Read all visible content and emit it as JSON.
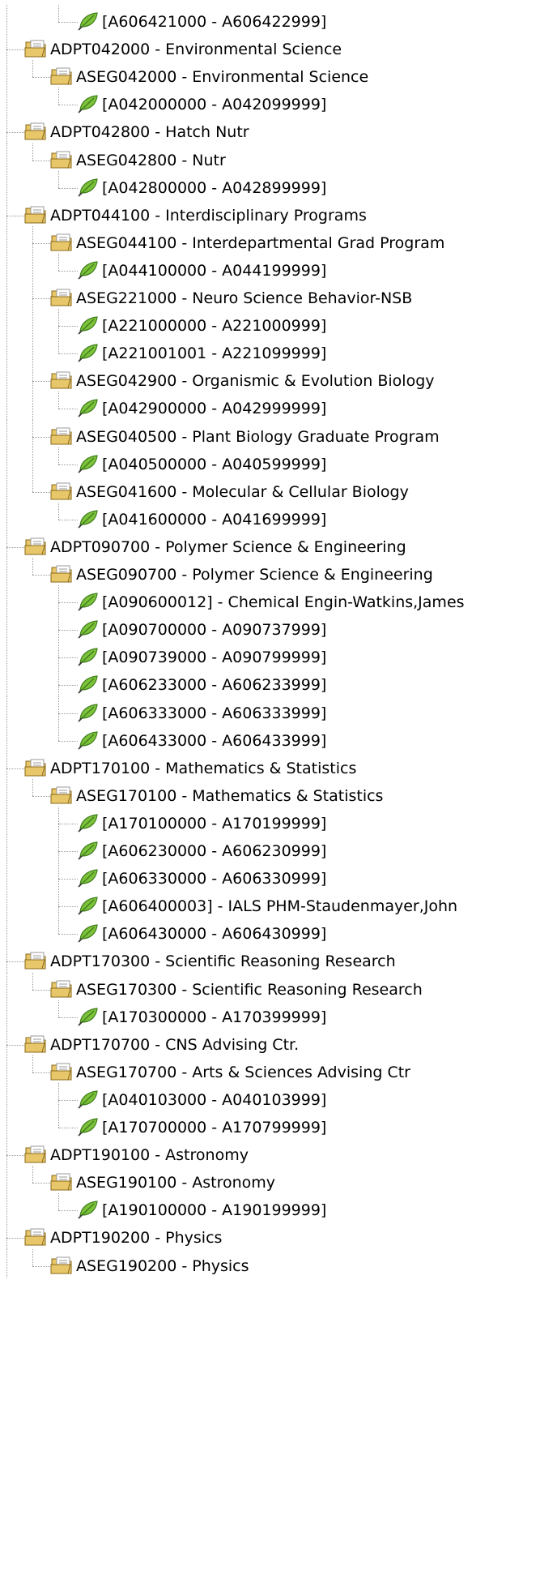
{
  "tree": {
    "rows": [
      {
        "level": 2,
        "type": "range",
        "label": "[A606421000 - A606422999]"
      },
      {
        "level": 0,
        "type": "folder",
        "label": "ADPT042000 - Environmental Science"
      },
      {
        "level": 1,
        "type": "folder",
        "label": "ASEG042000 - Environmental Science"
      },
      {
        "level": 2,
        "type": "range",
        "label": "[A042000000 - A042099999]"
      },
      {
        "level": 0,
        "type": "folder",
        "label": "ADPT042800 - Hatch Nutr"
      },
      {
        "level": 1,
        "type": "folder",
        "label": "ASEG042800 - Nutr"
      },
      {
        "level": 2,
        "type": "range",
        "label": "[A042800000 - A042899999]"
      },
      {
        "level": 0,
        "type": "folder",
        "label": "ADPT044100 - Interdisciplinary Programs"
      },
      {
        "level": 1,
        "type": "folder",
        "label": "ASEG044100 - Interdepartmental Grad Program"
      },
      {
        "level": 2,
        "type": "range",
        "label": "[A044100000 - A044199999]"
      },
      {
        "level": 1,
        "type": "folder",
        "label": "ASEG221000 - Neuro Science Behavior-NSB"
      },
      {
        "level": 2,
        "type": "range",
        "label": "[A221000000 - A221000999]"
      },
      {
        "level": 2,
        "type": "range",
        "label": "[A221001001 - A221099999]"
      },
      {
        "level": 1,
        "type": "folder",
        "label": "ASEG042900 - Organismic & Evolution Biology"
      },
      {
        "level": 2,
        "type": "range",
        "label": "[A042900000 - A042999999]"
      },
      {
        "level": 1,
        "type": "folder",
        "label": "ASEG040500 - Plant Biology Graduate Program"
      },
      {
        "level": 2,
        "type": "range",
        "label": "[A040500000 - A040599999]"
      },
      {
        "level": 1,
        "type": "folder",
        "label": "ASEG041600 - Molecular & Cellular Biology"
      },
      {
        "level": 2,
        "type": "range",
        "label": "[A041600000 - A041699999]"
      },
      {
        "level": 0,
        "type": "folder",
        "label": "ADPT090700 - Polymer Science & Engineering"
      },
      {
        "level": 1,
        "type": "folder",
        "label": "ASEG090700 - Polymer Science & Engineering"
      },
      {
        "level": 2,
        "type": "range",
        "label": "[A090600012] - Chemical Engin-Watkins,James"
      },
      {
        "level": 2,
        "type": "range",
        "label": "[A090700000 - A090737999]"
      },
      {
        "level": 2,
        "type": "range",
        "label": "[A090739000 - A090799999]"
      },
      {
        "level": 2,
        "type": "range",
        "label": "[A606233000 - A606233999]"
      },
      {
        "level": 2,
        "type": "range",
        "label": "[A606333000 - A606333999]"
      },
      {
        "level": 2,
        "type": "range",
        "label": "[A606433000 - A606433999]"
      },
      {
        "level": 0,
        "type": "folder",
        "label": "ADPT170100 - Mathematics & Statistics"
      },
      {
        "level": 1,
        "type": "folder",
        "label": "ASEG170100 - Mathematics & Statistics"
      },
      {
        "level": 2,
        "type": "range",
        "label": "[A170100000 - A170199999]"
      },
      {
        "level": 2,
        "type": "range",
        "label": "[A606230000 - A606230999]"
      },
      {
        "level": 2,
        "type": "range",
        "label": "[A606330000 - A606330999]"
      },
      {
        "level": 2,
        "type": "range",
        "label": "[A606400003] - IALS PHM-Staudenmayer,John"
      },
      {
        "level": 2,
        "type": "range",
        "label": "[A606430000 - A606430999]"
      },
      {
        "level": 0,
        "type": "folder",
        "label": "ADPT170300 - Scientific Reasoning Research"
      },
      {
        "level": 1,
        "type": "folder",
        "label": "ASEG170300 - Scientific Reasoning Research"
      },
      {
        "level": 2,
        "type": "range",
        "label": "[A170300000 - A170399999]"
      },
      {
        "level": 0,
        "type": "folder",
        "label": "ADPT170700 - CNS Advising Ctr."
      },
      {
        "level": 1,
        "type": "folder",
        "label": "ASEG170700 - Arts & Sciences Advising Ctr"
      },
      {
        "level": 2,
        "type": "range",
        "label": "[A040103000 - A040103999]"
      },
      {
        "level": 2,
        "type": "range",
        "label": "[A170700000 - A170799999]"
      },
      {
        "level": 0,
        "type": "folder",
        "label": "ADPT190100 - Astronomy"
      },
      {
        "level": 1,
        "type": "folder",
        "label": "ASEG190100 - Astronomy"
      },
      {
        "level": 2,
        "type": "range",
        "label": "[A190100000 - A190199999]"
      },
      {
        "level": 0,
        "type": "folder",
        "label": "ADPT190200 - Physics"
      },
      {
        "level": 1,
        "type": "folder",
        "label": "ASEG190200 - Physics"
      }
    ]
  },
  "colors": {
    "folder_body": "#e8c76a",
    "folder_outline": "#8a6a1a",
    "page_stripe": "#9a9a9a",
    "leaf_fill": "#7cc23a",
    "leaf_outline": "#3f7d1c",
    "connector": "#9a9a9a"
  },
  "icons": {
    "folder": "open-folder-icon",
    "range": "green-leaf-pen-icon"
  }
}
